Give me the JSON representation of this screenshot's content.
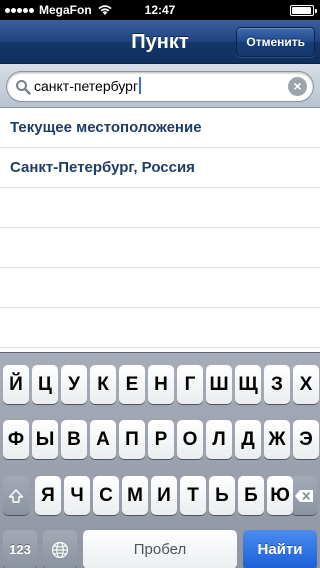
{
  "status_bar": {
    "carrier": "MegaFon",
    "time": "12:47",
    "battery_level": 0.95
  },
  "nav": {
    "title": "Пункт",
    "cancel_label": "Отменить"
  },
  "search": {
    "value": "санкт-петербург"
  },
  "results": [
    {
      "label": "Текущее местоположение"
    },
    {
      "label": "Санкт-Петербург, Россия"
    }
  ],
  "keyboard": {
    "row1": [
      "Й",
      "Ц",
      "У",
      "К",
      "Е",
      "Н",
      "Г",
      "Ш",
      "Щ",
      "З",
      "Х"
    ],
    "row2": [
      "Ф",
      "Ы",
      "В",
      "А",
      "П",
      "Р",
      "О",
      "Л",
      "Д",
      "Ж",
      "Э"
    ],
    "row3": [
      "Я",
      "Ч",
      "С",
      "М",
      "И",
      "Т",
      "Ь",
      "Б",
      "Ю"
    ],
    "numbers_label": "123",
    "space_label": "Пробел",
    "go_label": "Найти"
  },
  "icons": {
    "wifi": "wifi-icon",
    "battery": "battery-icon",
    "search": "search-icon",
    "clear": "clear-icon",
    "shift": "shift-icon",
    "delete": "backspace-icon",
    "globe": "globe-icon"
  },
  "colors": {
    "nav": "#1f4480",
    "result_text": "#1f3d6b",
    "go_key": "#1c5fd8"
  }
}
